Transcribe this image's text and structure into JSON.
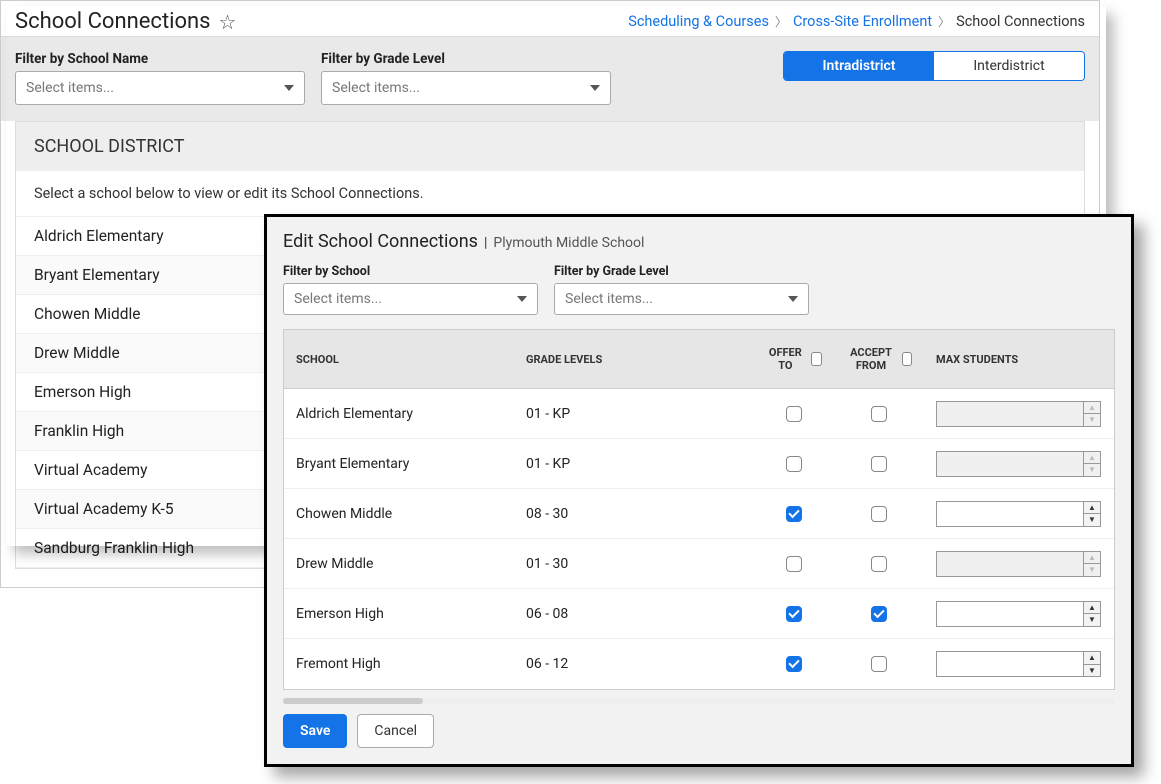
{
  "header": {
    "title": "School Connections",
    "breadcrumb": {
      "a": "Scheduling & Courses",
      "b": "Cross-Site Enrollment",
      "current": "School Connections"
    }
  },
  "filters": {
    "school_label": "Filter by School Name",
    "school_placeholder": "Select items...",
    "grade_label": "Filter by Grade Level",
    "grade_placeholder": "Select items..."
  },
  "segmented": {
    "intra": "Intradistrict",
    "inter": "Interdistrict"
  },
  "district": {
    "header": "SCHOOL DISTRICT",
    "instruction": "Select a school below to view or edit its School Connections.",
    "schools": [
      "Aldrich Elementary",
      "Bryant Elementary",
      "Chowen Middle",
      "Drew Middle",
      "Emerson High",
      "Franklin High",
      "Virtual Academy",
      "Virtual Academy K-5",
      "Sandburg Franklin High"
    ]
  },
  "modal": {
    "title": "Edit School Connections",
    "subtitle": "Plymouth Middle School",
    "filters": {
      "school_label": "Filter by School",
      "school_placeholder": "Select items...",
      "grade_label": "Filter by Grade Level",
      "grade_placeholder": "Select items..."
    },
    "columns": {
      "school": "SCHOOL",
      "grade": "GRADE LEVELS",
      "offer": "OFFER TO",
      "accept": "ACCEPT FROM",
      "max": "MAX STUDENTS"
    },
    "rows": [
      {
        "school": "Aldrich Elementary",
        "grade": "01 - KP",
        "offer": false,
        "accept": false,
        "max_enabled": false
      },
      {
        "school": "Bryant Elementary",
        "grade": "01 - KP",
        "offer": false,
        "accept": false,
        "max_enabled": false
      },
      {
        "school": "Chowen Middle",
        "grade": "08 - 30",
        "offer": true,
        "accept": false,
        "max_enabled": true
      },
      {
        "school": "Drew Middle",
        "grade": "01 - 30",
        "offer": false,
        "accept": false,
        "max_enabled": false
      },
      {
        "school": "Emerson High",
        "grade": "06 - 08",
        "offer": true,
        "accept": true,
        "max_enabled": true
      },
      {
        "school": "Fremont High",
        "grade": "06 - 12",
        "offer": true,
        "accept": false,
        "max_enabled": true
      }
    ],
    "actions": {
      "save": "Save",
      "cancel": "Cancel"
    }
  }
}
